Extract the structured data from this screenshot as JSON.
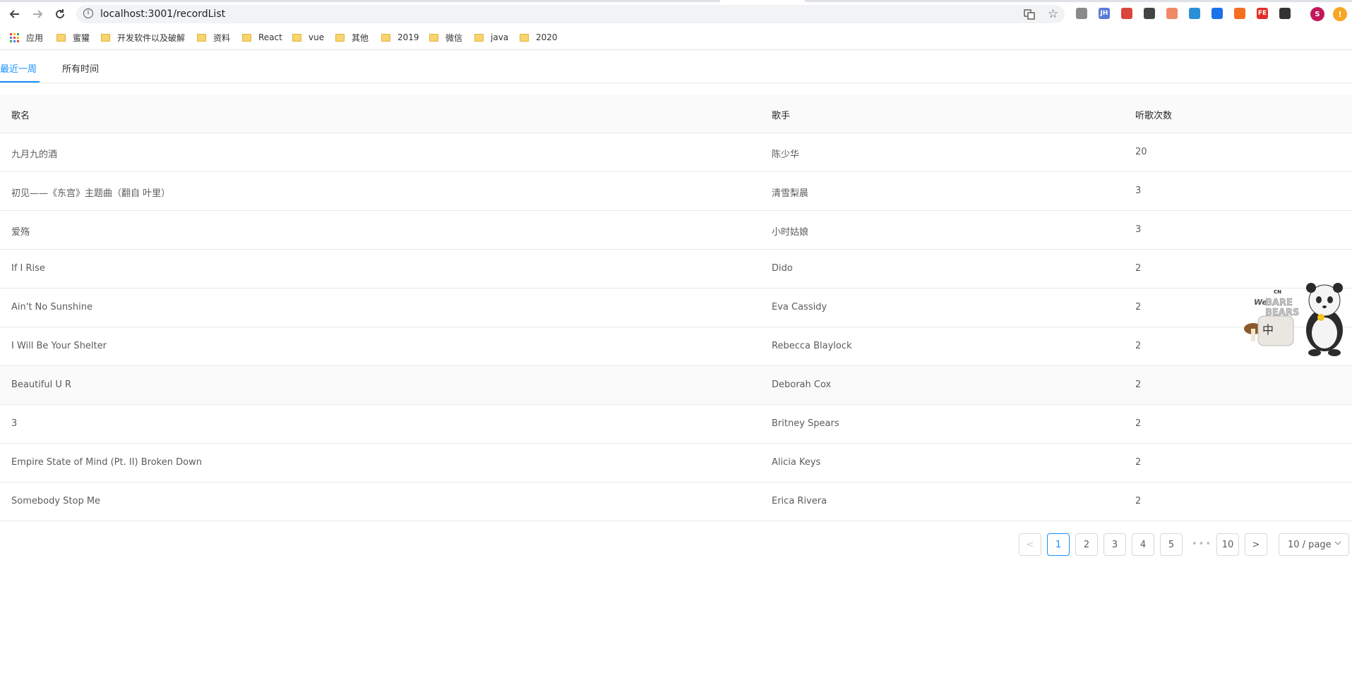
{
  "browser": {
    "url": "localhost:3001/recordList",
    "back_icon": "arrow-left-icon",
    "forward_icon": "arrow-right-icon",
    "reload_icon": "reload-icon",
    "extensions": [
      {
        "name": "vue-devtools-icon",
        "label": "",
        "color": "#8a8a8a"
      },
      {
        "name": "jh-extension-icon",
        "label": "JH",
        "color": "#5b7bd5"
      },
      {
        "name": "red-extension-icon",
        "label": "",
        "color": "#d9463d"
      },
      {
        "name": "qr-code-icon",
        "label": "",
        "color": "#444444"
      },
      {
        "name": "orange-extension-icon",
        "label": "",
        "color": "#f08a65"
      },
      {
        "name": "pinwheel-extension-icon",
        "label": "",
        "color": "#2a8fd6"
      },
      {
        "name": "blue-extension-icon",
        "label": "",
        "color": "#1a73e8"
      },
      {
        "name": "orange-circle-extension-icon",
        "label": "",
        "color": "#f37021"
      },
      {
        "name": "fe-extension-icon",
        "label": "FE",
        "color": "#e52d27"
      },
      {
        "name": "dark-extension-icon",
        "label": "",
        "color": "#333333"
      }
    ],
    "profile_initial": "S",
    "profile_color": "#c2185b",
    "update_badge_color": "#f5a623"
  },
  "bookmarks": {
    "apps_label": "应用",
    "folders": [
      "蜜獾",
      "开发软件以及破解",
      "资料",
      "React",
      "vue",
      "其他",
      "2019",
      "微信",
      "java",
      "2020"
    ]
  },
  "tabs": {
    "recent_week": "最近一周",
    "all_time": "所有时间",
    "active_color": "#1890ff"
  },
  "table": {
    "headers": {
      "song": "歌名",
      "singer": "歌手",
      "plays": "听歌次数"
    },
    "rows": [
      {
        "song": "九月九的酒",
        "singer": "陈少华",
        "plays": "20"
      },
      {
        "song": "初见——《东宫》主题曲（翻自 叶里）",
        "singer": "清雪梨晨",
        "plays": "3"
      },
      {
        "song": "爱殇",
        "singer": "小时姑娘",
        "plays": "3"
      },
      {
        "song": "If I Rise",
        "singer": "Dido",
        "plays": "2"
      },
      {
        "song": "Ain't No Sunshine",
        "singer": "Eva Cassidy",
        "plays": "2"
      },
      {
        "song": "I Will Be Your Shelter",
        "singer": "Rebecca Blaylock",
        "plays": "2"
      },
      {
        "song": "Beautiful U R",
        "singer": "Deborah Cox",
        "plays": "2"
      },
      {
        "song": "3",
        "singer": "Britney Spears",
        "plays": "2"
      },
      {
        "song": "Empire State of Mind (Pt. II) Broken Down",
        "singer": "Alicia Keys",
        "plays": "2"
      },
      {
        "song": "Somebody Stop Me",
        "singer": "Erica Rivera",
        "plays": "2"
      }
    ]
  },
  "pagination": {
    "prev": "<",
    "pages": [
      "1",
      "2",
      "3",
      "4",
      "5"
    ],
    "ellipsis": "•••",
    "last": "10",
    "next": ">",
    "current": "1",
    "page_size": "10 / page"
  },
  "sticker": {
    "network_logo": "CN",
    "brand_line1": "We",
    "brand_line2": "BARE",
    "brand_line3": "BEARS",
    "sign_text": "中"
  }
}
